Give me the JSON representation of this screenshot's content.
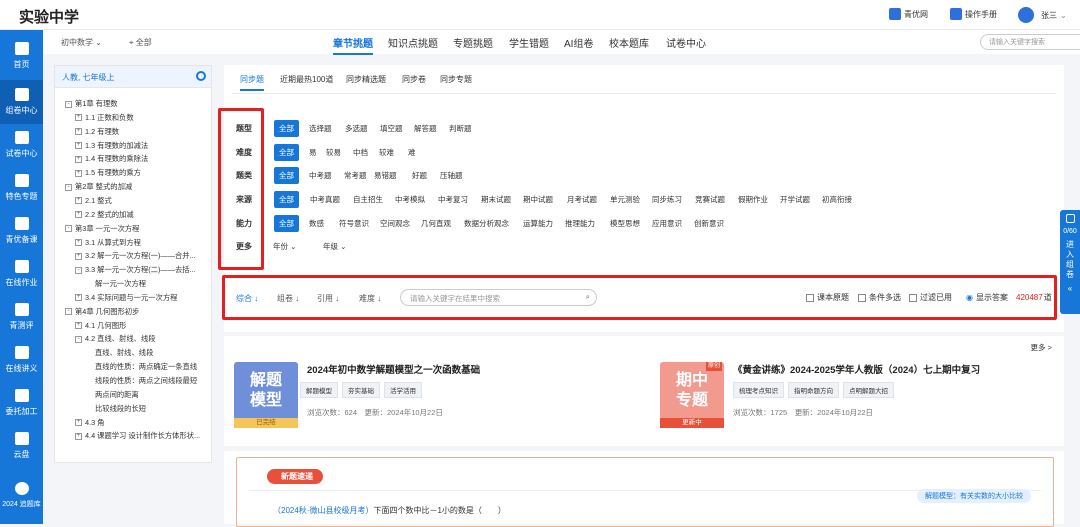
{
  "app": {
    "title": "实验中学"
  },
  "top_links": [
    {
      "label": "青优网",
      "icon": "school-icon"
    },
    {
      "label": "操作手册",
      "icon": "manual-icon"
    },
    {
      "label": "张三",
      "icon": "user-avatar-icon"
    }
  ],
  "sidebar": {
    "items": [
      {
        "label": "首页",
        "icon": "home-icon"
      },
      {
        "label": "组卷中心",
        "icon": "cube-icon"
      },
      {
        "label": "试卷中心",
        "icon": "paper-icon"
      },
      {
        "label": "特色专题",
        "icon": "star-icon"
      },
      {
        "label": "青优备课",
        "icon": "briefcase-icon"
      },
      {
        "label": "在线作业",
        "icon": "edit-icon"
      },
      {
        "label": "青测评",
        "icon": "assessment-icon"
      },
      {
        "label": "在线讲义",
        "icon": "notes-icon"
      },
      {
        "label": "委托加工",
        "icon": "task-icon"
      },
      {
        "label": "云盘",
        "icon": "cloud-icon"
      },
      {
        "label": "2024 追题库",
        "icon": "question-bank-icon"
      }
    ]
  },
  "filters": {
    "grade": "初中数学",
    "region": "全部"
  },
  "main_tabs": [
    "章节挑题",
    "知识点挑题",
    "专题挑题",
    "学生错题",
    "AI组卷",
    "校本题库",
    "试卷中心"
  ],
  "search": {
    "placeholder": "请输入关键字搜索"
  },
  "tree": {
    "header": "人教, 七年级上",
    "nodes": [
      "第1章 有理数",
      "1.1 正数和负数",
      "1.2 有理数",
      "1.3 有理数的加减法",
      "1.4 有理数的乘除法",
      "1.5 有理数的乘方",
      "第2章 整式的加减",
      "2.1 整式",
      "2.2 整式的加减",
      "第3章 一元一次方程",
      "3.1 从算式到方程",
      "3.2 解一元一次方程(一)——合并...",
      "3.3 解一元一次方程(二)——去括...",
      "解一元一次方程",
      "3.4 实际问题与一元一次方程",
      "第4章 几何图形初步",
      "4.1 几何图形",
      "4.2 直线、射线、线段",
      "直线、射线、线段",
      "直线的性质：两点确定一条直线",
      "线段的性质：两点之间线段最短",
      "两点间的距离",
      "比较线段的长短",
      "4.3 角",
      "4.4 课题学习 设计制作长方体形状..."
    ]
  },
  "subtabs": [
    "同步题",
    "近期最热100道",
    "同步精选题",
    "同步卷",
    "同步专题"
  ],
  "filter_rows": [
    {
      "label": "题型",
      "options": [
        "全部",
        "选择题",
        "多选题",
        "填空题",
        "解答题",
        "判断题"
      ]
    },
    {
      "label": "难度",
      "options": [
        "全部",
        "易",
        "较易",
        "中档",
        "较难",
        "难"
      ]
    },
    {
      "label": "题类",
      "options": [
        "全部",
        "中考题",
        "常考题",
        "易错题",
        "好题",
        "压轴题"
      ]
    },
    {
      "label": "来源",
      "options": [
        "全部",
        "中考真题",
        "自主招生",
        "中考模拟",
        "中考复习",
        "期末试题",
        "期中试题",
        "月考试题",
        "单元测验",
        "同步练习",
        "竞赛试题",
        "假期作业",
        "开学试题",
        "初高衔接"
      ]
    },
    {
      "label": "能力",
      "options": [
        "全部",
        "数感",
        "符号意识",
        "空间观念",
        "几何直观",
        "数据分析观念",
        "运算能力",
        "推理能力",
        "模型思想",
        "应用意识",
        "创新意识"
      ]
    },
    {
      "label": "更多",
      "options": [
        "年份",
        "年级"
      ]
    }
  ],
  "sortbar": {
    "sorts": [
      "综合",
      "组卷",
      "引用",
      "难度"
    ],
    "search_placeholder": "请输入关键字在结果中搜索",
    "checks": [
      "课本原题",
      "条件多选",
      "过滤已用"
    ],
    "show_answer": "显示答案",
    "count": "420487",
    "count_unit": "道"
  },
  "float_panel": {
    "count": "0/60",
    "label": "进入组卷"
  },
  "cards": {
    "more": "更多 >",
    "items": [
      {
        "cover_text": "解题模型",
        "ribbon": "已完结",
        "title": "2024年初中数学解题模型之一次函数基础",
        "tags": [
          "解题模型",
          "夯实基础",
          "活学活用"
        ],
        "views": "浏览次数：624",
        "updated": "更新：2024年10月22日",
        "color": "#6f8fd9"
      },
      {
        "cover_text": "期中专题",
        "ribbon": "更新中",
        "badge": "原创",
        "title": "《黄金讲练》2024-2025学年人教版（2024）七上期中复习",
        "tags": [
          "梳理考点知识",
          "指明命题方向",
          "点明解题大招"
        ],
        "views": "浏览次数：1725",
        "updated": "更新：2024年10月22日",
        "color": "#f29a8e"
      }
    ]
  },
  "question": {
    "badge": "新题速递",
    "tag": "解题模型：有关实数的大小比较",
    "source": "（2024秋·微山县校级月考）",
    "text": "下面四个数中比－1小的数是（　　）"
  }
}
